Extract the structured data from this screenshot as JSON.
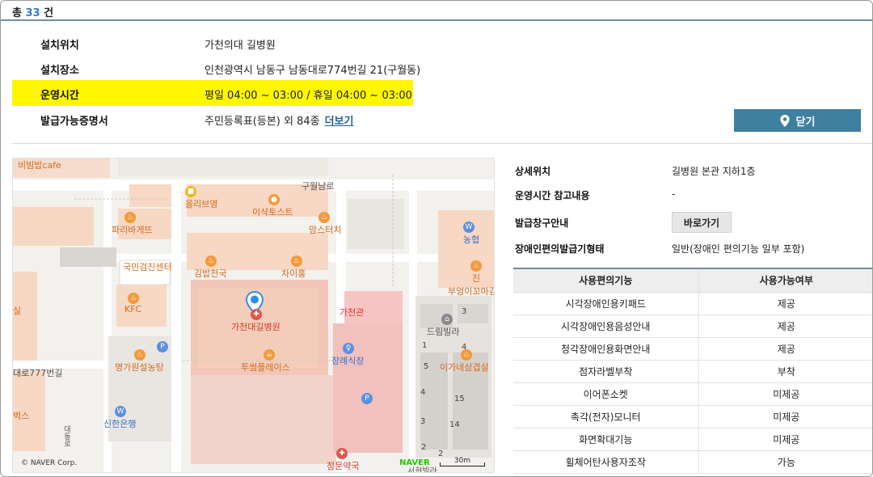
{
  "summary": {
    "prefix": "총",
    "count": "33",
    "suffix": "건"
  },
  "info": [
    {
      "label": "설치위치",
      "value": "가천의대 길병원"
    },
    {
      "label": "설치장소",
      "value": "인천광역시 남동구 남동대로774번길 21(구월동)"
    },
    {
      "label": "운영시간",
      "value": "평일 04:00 ~ 03:00 / 휴일 04:00 ~ 03:00"
    },
    {
      "label": "발급가능증명서",
      "value": "주민등록표(등본) 외 84종",
      "more": "더보기"
    }
  ],
  "close_button": {
    "label": "닫기",
    "icon": "location-pin-icon"
  },
  "map": {
    "labels": {
      "bibimbap": "비빔밥cafe",
      "guwol": "구월남로",
      "oliveyoung": "올리브영",
      "isaac": "이삭토스트",
      "paris": "파리바게뜨",
      "momstouch": "맘스터치",
      "nonghyup": "농협",
      "kookmin": "국민검진센터",
      "kimbap": "김밥천국",
      "chaihong": "차이홍",
      "jin": "진",
      "buengi": "부엉이꼬마김",
      "kfc": "KFC",
      "hospital": "가천대길병원",
      "gachon_hall": "가천관",
      "dream_villa": "드림빌라",
      "twosome": "투썸플레이스",
      "funeral": "장례식장",
      "myeonggawon": "명가원설농탕",
      "igane": "이가네삼겹살",
      "road774": "대로777번길",
      "shinhan": "신한은행",
      "jeongmun": "정문약국",
      "seohyeon": "서현빌라",
      "sil": "실",
      "beoks": "벅스",
      "dongro": "대동로"
    },
    "building_numbers": [
      "3",
      "1",
      "4",
      "5",
      "15",
      "4",
      "3",
      "14",
      "2",
      "2"
    ],
    "copyright": "© NAVER Corp.",
    "brand": "NAVER",
    "scale": "30m"
  },
  "details": [
    {
      "label": "상세위치",
      "value": "길병원 본관 지하1층"
    },
    {
      "label": "운영시간 참고내용",
      "value": "-"
    },
    {
      "label": "발급창구안내",
      "button": "바로가기"
    },
    {
      "label": "장애인편의발급기형태",
      "value": "일반(장애인 편의기능 일부 포함)"
    }
  ],
  "features": {
    "headers": [
      "사용편의기능",
      "사용가능여부"
    ],
    "rows": [
      [
        "시각장애인용키패드",
        "제공"
      ],
      [
        "시각장애인용음성안내",
        "제공"
      ],
      [
        "청각장애인용화면안내",
        "제공"
      ],
      [
        "점자라벨부착",
        "부착"
      ],
      [
        "이어폰소켓",
        "미제공"
      ],
      [
        "촉각(전자)모니터",
        "미제공"
      ],
      [
        "화면확대기능",
        "미제공"
      ],
      [
        "휠체어탄사용자조작",
        "가능"
      ]
    ]
  }
}
